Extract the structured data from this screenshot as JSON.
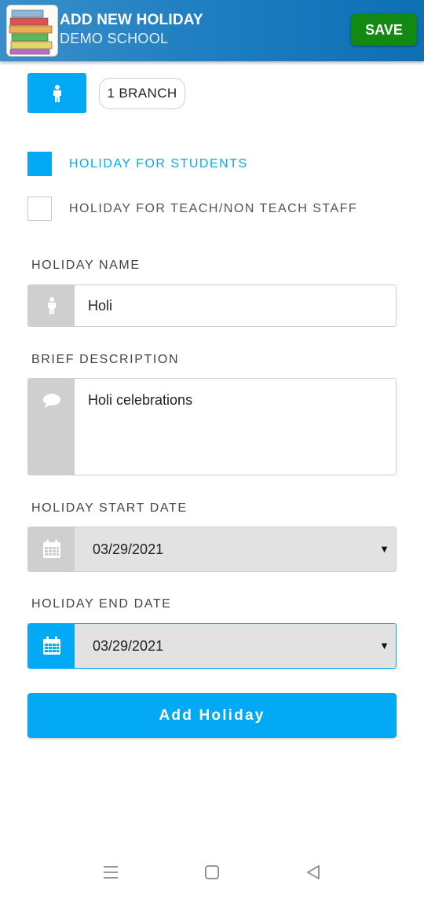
{
  "header": {
    "title": "ADD NEW HOLIDAY",
    "subtitle": "DEMO SCHOOL",
    "save_label": "SAVE",
    "logo_books": [
      "MATH",
      "READING",
      "SCIENCE",
      "HISTORY",
      "READING"
    ]
  },
  "branch": {
    "icon": "person-icon",
    "label": "1 BRANCH"
  },
  "audience": {
    "students": {
      "label": "HOLIDAY FOR STUDENTS",
      "checked": true
    },
    "staff": {
      "label": "HOLIDAY FOR TEACH/NON TEACH STAFF",
      "checked": false
    }
  },
  "form": {
    "name": {
      "label": "HOLIDAY NAME",
      "value": "Holi",
      "icon": "person-icon"
    },
    "description": {
      "label": "BRIEF DESCRIPTION",
      "value": "Holi celebrations",
      "icon": "speech-bubble-icon"
    },
    "start_date": {
      "label": "HOLIDAY START DATE",
      "value": "03/29/2021",
      "icon": "calendar-icon"
    },
    "end_date": {
      "label": "HOLIDAY END DATE",
      "value": "03/29/2021",
      "icon": "calendar-icon"
    }
  },
  "add_button_label": "Add Holiday",
  "colors": {
    "accent": "#03a9f4",
    "save_green": "#128a12",
    "header_blue": "#1b7cc0",
    "disabled_gray": "#cfcfcf"
  },
  "system_nav": [
    "menu-icon",
    "home-icon",
    "back-icon"
  ]
}
